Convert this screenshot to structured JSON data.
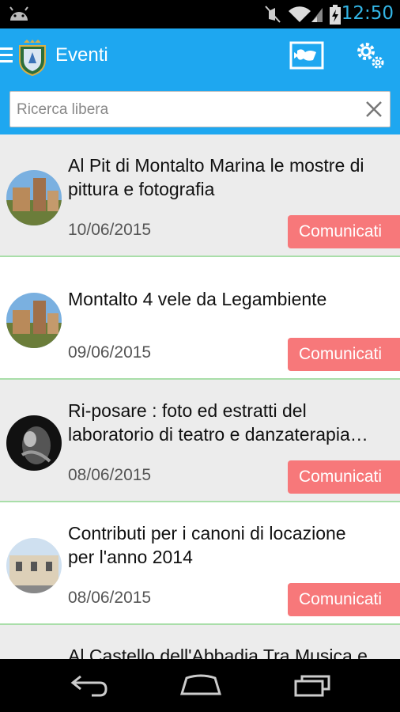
{
  "status_bar": {
    "time": "12:50",
    "icons": [
      "android-icon",
      "mute-icon",
      "wifi-icon",
      "signal-icon",
      "battery-icon"
    ]
  },
  "app_bar": {
    "title": "Eventi",
    "icons": [
      "menu-icon",
      "crest-logo",
      "map-icon",
      "settings-icon"
    ],
    "color": "#1ea7f0"
  },
  "search": {
    "value": "",
    "placeholder": "Ricerca libera"
  },
  "events": [
    {
      "title_line1": "Al Pit di Montalto Marina le mostre di",
      "title_line2": "pittura e fotografia",
      "date": "10/06/2015",
      "badge": "Comunicati"
    },
    {
      "title_line1": "Montalto 4 vele da Legambiente",
      "title_line2": "",
      "date": "09/06/2015",
      "badge": "Comunicati"
    },
    {
      "title_line1": "Ri-posare : foto ed estratti del",
      "title_line2": "laboratorio di teatro e danzaterapia…",
      "date": "08/06/2015",
      "badge": "Comunicati"
    },
    {
      "title_line1": "Contributi per i canoni di locazione",
      "title_line2": "per l'anno 2014",
      "date": "08/06/2015",
      "badge": "Comunicati"
    },
    {
      "title_line1": "Al Castello dell'Abbadia Tra Musica e",
      "title_line2": "",
      "date": "",
      "badge": ""
    }
  ],
  "colors": {
    "badge": "#f7787a",
    "divider": "#a9dea9",
    "accent": "#33b5e5"
  }
}
